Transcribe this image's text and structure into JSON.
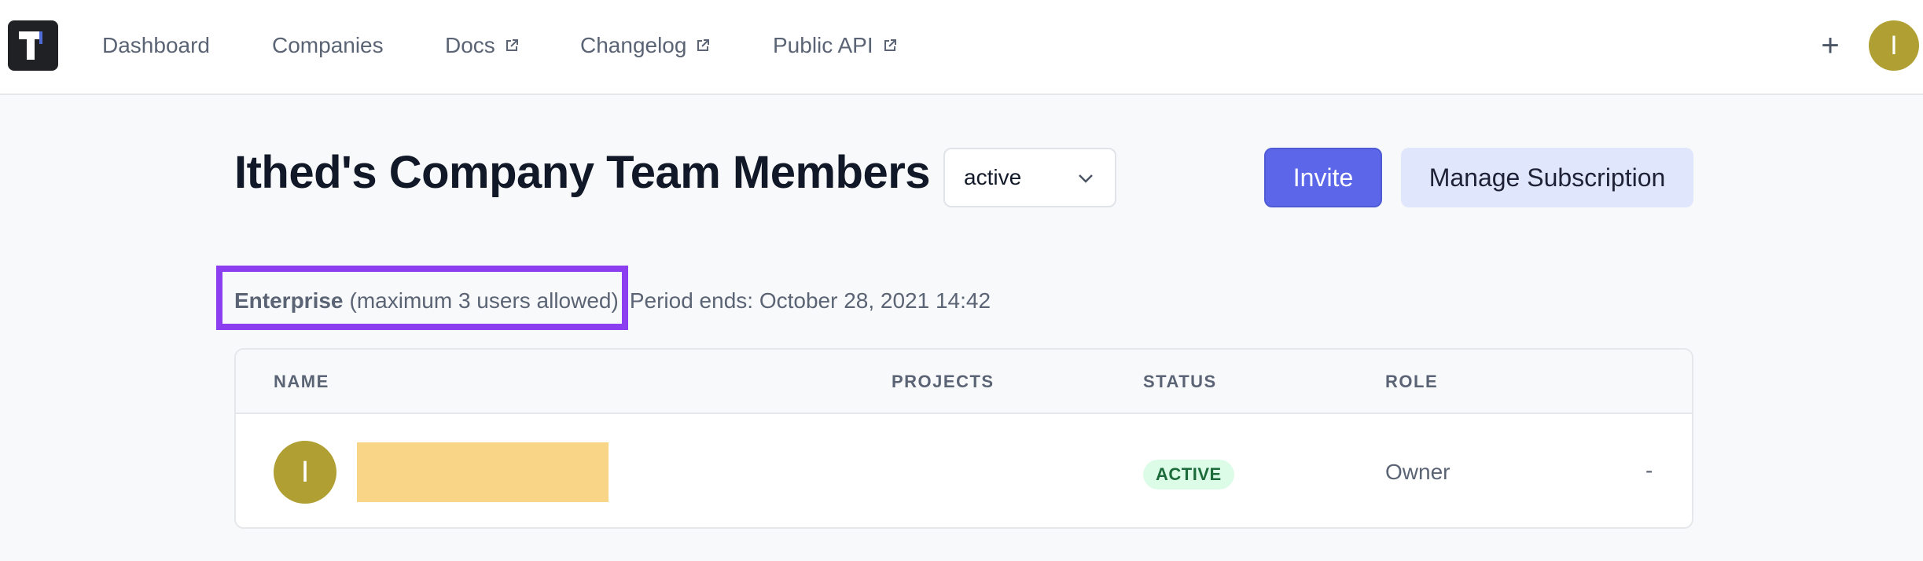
{
  "nav": {
    "items": [
      {
        "label": "Dashboard",
        "external": false
      },
      {
        "label": "Companies",
        "external": false
      },
      {
        "label": "Docs",
        "external": true
      },
      {
        "label": "Changelog",
        "external": true
      },
      {
        "label": "Public API",
        "external": true
      }
    ],
    "plus_label": "+",
    "avatar_initial": "I"
  },
  "header": {
    "title": "Ithed's Company Team Members",
    "status_filter": {
      "value": "active"
    },
    "invite_label": "Invite",
    "manage_label": "Manage Subscription"
  },
  "plan": {
    "name": "Enterprise",
    "limit_text": "(maximum 3 users allowed)",
    "period_text": "Period ends: October 28, 2021 14:42"
  },
  "table": {
    "columns": [
      "NAME",
      "PROJECTS",
      "STATUS",
      "ROLE"
    ],
    "rows": [
      {
        "avatar_initial": "I",
        "name": "",
        "projects": "",
        "status": "ACTIVE",
        "role": "Owner",
        "action": "-"
      }
    ]
  },
  "colors": {
    "accent": "#5b67e8",
    "avatar": "#b09f33",
    "highlight": "#8b3ff0",
    "status_active_bg": "#dcfce7",
    "redaction": "#f8d587"
  }
}
